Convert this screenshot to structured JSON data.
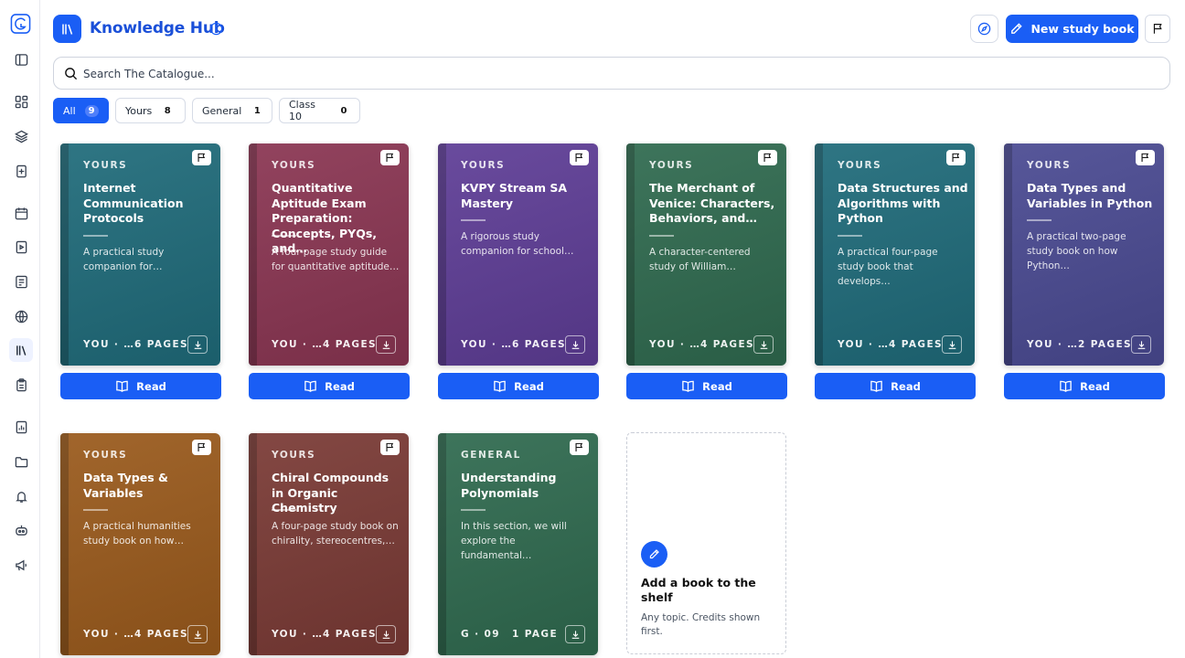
{
  "header": {
    "title": "Knowledge Hub",
    "new_button": "New study book"
  },
  "search": {
    "placeholder": "Search The Catalogue..."
  },
  "filters": [
    {
      "label": "All",
      "count": "9",
      "active": true
    },
    {
      "label": "Yours",
      "count": "8"
    },
    {
      "label": "General",
      "count": "1"
    },
    {
      "label": "Class 10",
      "count": "0"
    }
  ],
  "books": [
    {
      "category": "YOURS",
      "title": "Internet Communication Protocols",
      "desc": "A practical study companion for…",
      "owner": "YOU · …",
      "pages": "6 PAGES",
      "color": "#1f6b7a"
    },
    {
      "category": "YOURS",
      "title": "Quantitative Aptitude Exam Preparation: Concepts, PYQs, and…",
      "desc": "A four-page study guide for quantitative aptitude…",
      "owner": "YOU · …",
      "pages": "4 PAGES",
      "color": "#8a3552"
    },
    {
      "category": "YOURS",
      "title": "KVPY Stream SA Mastery",
      "desc": "A rigorous study companion for school…",
      "owner": "YOU · …",
      "pages": "6 PAGES",
      "color": "#5e3d96"
    },
    {
      "category": "YOURS",
      "title": "The Merchant of Venice: Characters, Behaviors, and…",
      "desc": "A character-centered study of William…",
      "owner": "YOU · …",
      "pages": "4 PAGES",
      "color": "#2f6a4f"
    },
    {
      "category": "YOURS",
      "title": "Data Structures and Algorithms with Python",
      "desc": "A practical four-page study book that develops…",
      "owner": "YOU · …",
      "pages": "4 PAGES",
      "color": "#1f6b7a"
    },
    {
      "category": "YOURS",
      "title": "Data Types and Variables in Python",
      "desc": "A practical two-page study book on how Python…",
      "owner": "YOU · …",
      "pages": "2 PAGES",
      "color": "#4a4a92"
    },
    {
      "category": "YOURS",
      "title": "Data Types & Variables",
      "desc": "A practical humanities study book on how…",
      "owner": "YOU · …",
      "pages": "4 PAGES",
      "color": "#9a5a1c"
    },
    {
      "category": "YOURS",
      "title": "Chiral Compounds in Organic Chemistry",
      "desc": "A four-page study book on chirality, stereocentres,…",
      "owner": "YOU · …",
      "pages": "4 PAGES",
      "color": "#7a3a35"
    },
    {
      "category": "GENERAL",
      "title": "Understanding Polynomials",
      "desc": "In this section, we will explore the fundamental…",
      "owner": "G · 09",
      "pages": "1 PAGE",
      "color": "#2f6a4f"
    }
  ],
  "read_label": "Read",
  "add_card": {
    "title": "Add a book to the shelf",
    "subtitle": "Any topic. Credits shown first."
  }
}
